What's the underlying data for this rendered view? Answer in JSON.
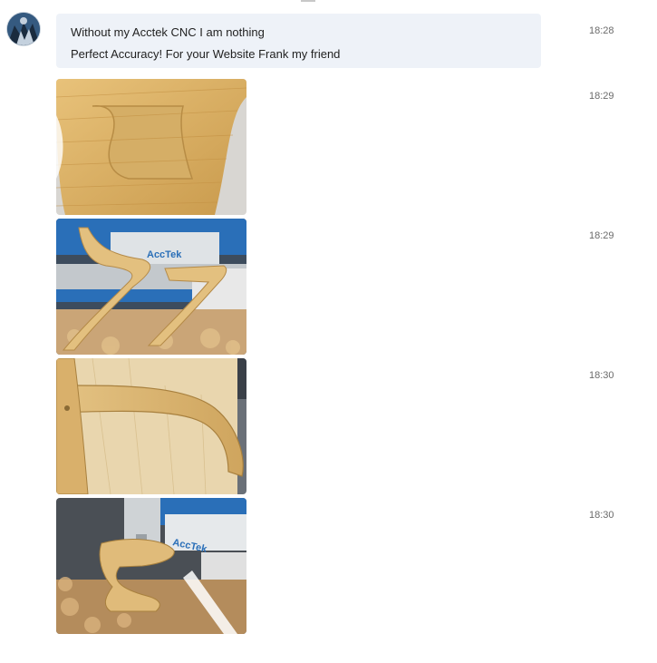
{
  "messages": [
    {
      "type": "text",
      "lines": [
        "Without my Acctek CNC I am nothing",
        "Perfect Accuracy! For your Website Frank my friend"
      ],
      "time": "18:28"
    },
    {
      "type": "image",
      "subject": "oak-bentwood-seat-closeup",
      "time": "18:29"
    },
    {
      "type": "image",
      "subject": "zigzag-wooden-chair-on-cnc-bed",
      "time": "18:29"
    },
    {
      "type": "image",
      "subject": "curved-wooden-armrest-closeup",
      "time": "18:30"
    },
    {
      "type": "image",
      "subject": "wooden-chair-under-cnc-spindle",
      "time": "18:30"
    }
  ],
  "machine_logo_text": "AccTek",
  "colors": {
    "bubble_bg": "#eef2f8",
    "timestamp": "#6b6b6b",
    "wood": "#d9b16a",
    "machine_blue": "#2a6fb8"
  },
  "avatar": {
    "icon": "user-avatar"
  }
}
